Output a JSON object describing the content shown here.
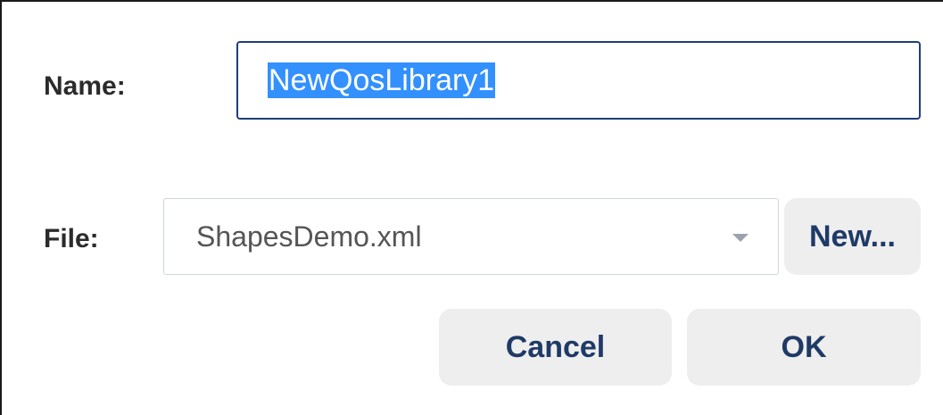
{
  "form": {
    "name_label": "Name:",
    "name_value": "NewQosLibrary1",
    "file_label": "File:",
    "file_value": "ShapesDemo.xml",
    "new_label": "New...",
    "cancel_label": "Cancel",
    "ok_label": "OK"
  },
  "colors": {
    "accent": "#1f3f78",
    "selection": "#3390ff",
    "button_bg": "#eeeeee",
    "button_text": "#1e3a66"
  },
  "icons": {
    "dropdown": "chevron-down-icon"
  }
}
